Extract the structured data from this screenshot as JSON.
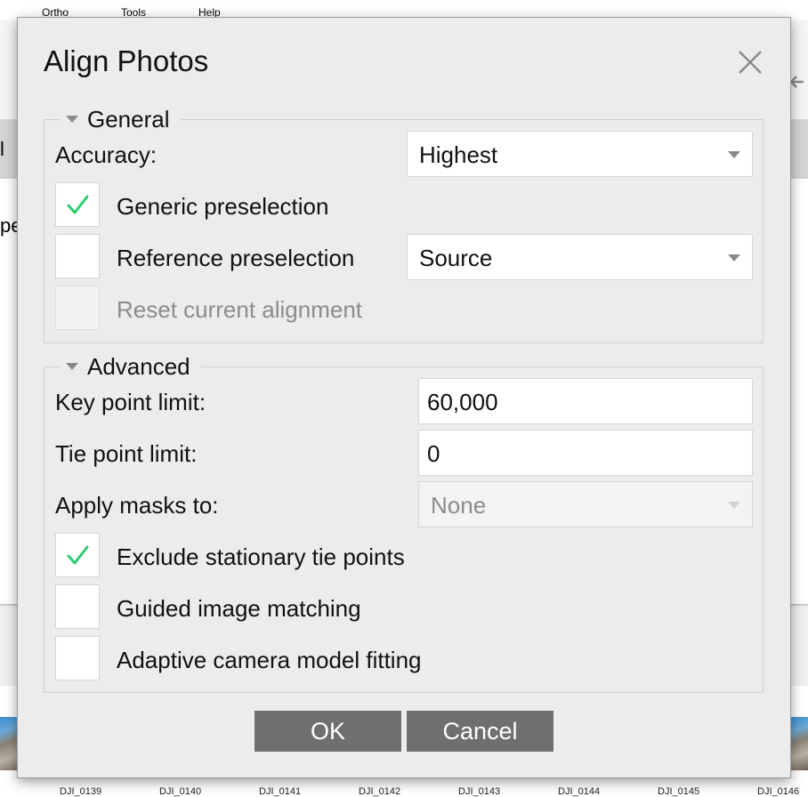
{
  "app": {
    "menu": [
      "Ortho",
      "Tools",
      "Help"
    ],
    "edge_text_left_1": "l",
    "edge_text_left_2": "pe",
    "thumbnails": [
      "DJI_0139",
      "DJI_0140",
      "DJI_0141",
      "DJI_0142",
      "DJI_0143",
      "DJI_0144",
      "DJI_0145",
      "DJI_0146"
    ]
  },
  "dialog": {
    "title": "Align Photos",
    "close_icon": "close-icon",
    "general": {
      "title": "General",
      "accuracy_label": "Accuracy:",
      "accuracy_value": "Highest",
      "generic_preselection_label": "Generic preselection",
      "generic_preselection_checked": true,
      "reference_preselection_label": "Reference preselection",
      "reference_preselection_checked": false,
      "reference_preselection_value": "Source",
      "reset_alignment_label": "Reset current alignment",
      "reset_alignment_checked": false,
      "reset_alignment_enabled": false
    },
    "advanced": {
      "title": "Advanced",
      "key_point_limit_label": "Key point limit:",
      "key_point_limit_value": "60,000",
      "tie_point_limit_label": "Tie point limit:",
      "tie_point_limit_value": "0",
      "apply_masks_label": "Apply masks to:",
      "apply_masks_value": "None",
      "apply_masks_enabled": false,
      "exclude_stationary_label": "Exclude stationary tie points",
      "exclude_stationary_checked": true,
      "guided_matching_label": "Guided image matching",
      "guided_matching_checked": false,
      "adaptive_fitting_label": "Adaptive camera model fitting",
      "adaptive_fitting_checked": false
    },
    "buttons": {
      "ok": "OK",
      "cancel": "Cancel"
    },
    "colors": {
      "check_green": "#2ecc71",
      "button_bg": "#6f6f6f",
      "dialog_bg": "#ececec"
    }
  }
}
